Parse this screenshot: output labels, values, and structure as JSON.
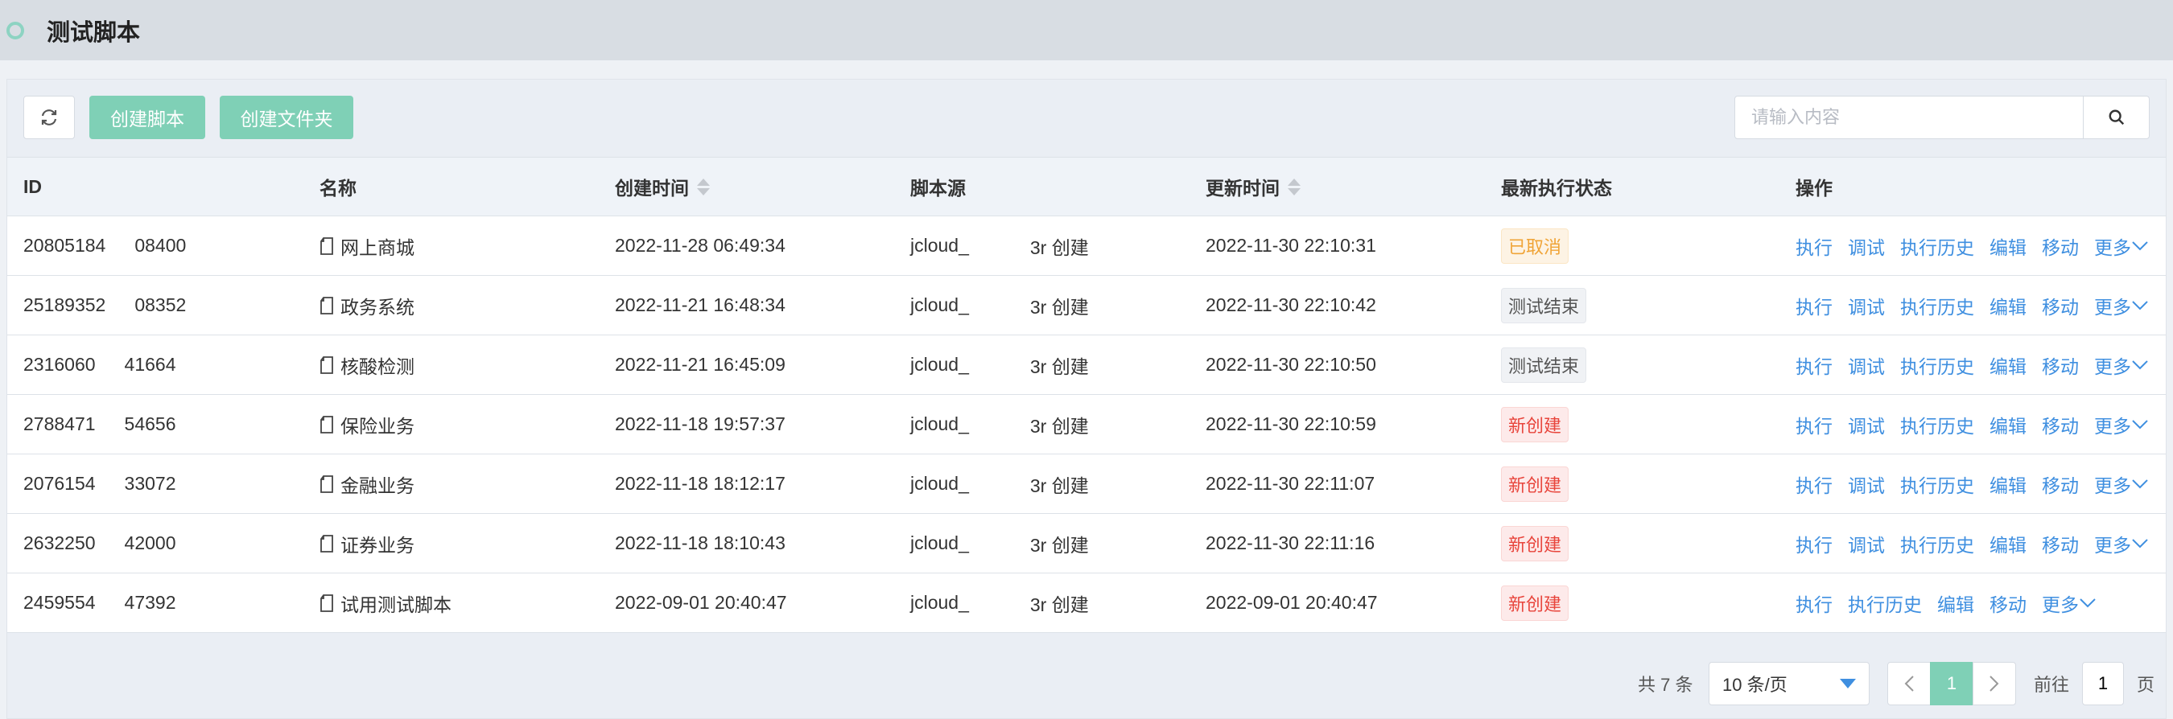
{
  "header": {
    "title": "测试脚本"
  },
  "toolbar": {
    "create_script_label": "创建脚本",
    "create_folder_label": "创建文件夹",
    "search_placeholder": "请输入内容"
  },
  "table": {
    "columns": [
      "ID",
      "名称",
      "创建时间",
      "脚本源",
      "更新时间",
      "最新执行状态",
      "操作"
    ],
    "rows": [
      {
        "id_prefix": "20805184",
        "id_suffix": "08400",
        "name": "网上商城",
        "created": "2022-11-28 06:49:34",
        "src_prefix": "jcloud_",
        "src_suffix": "3r 创建",
        "updated": "2022-11-30 22:10:31",
        "status": "已取消",
        "status_type": "cancel"
      },
      {
        "id_prefix": "25189352",
        "id_suffix": "08352",
        "name": "政务系统",
        "created": "2022-11-21 16:48:34",
        "src_prefix": "jcloud_",
        "src_suffix": "3r 创建",
        "updated": "2022-11-30 22:10:42",
        "status": "测试结束",
        "status_type": "done"
      },
      {
        "id_prefix": "2316060",
        "id_suffix": "41664",
        "name": "核酸检测",
        "created": "2022-11-21 16:45:09",
        "src_prefix": "jcloud_",
        "src_suffix": "3r 创建",
        "updated": "2022-11-30 22:10:50",
        "status": "测试结束",
        "status_type": "done"
      },
      {
        "id_prefix": "2788471",
        "id_suffix": "54656",
        "name": "保险业务",
        "created": "2022-11-18 19:57:37",
        "src_prefix": "jcloud_",
        "src_suffix": "3r 创建",
        "updated": "2022-11-30 22:10:59",
        "status": "新创建",
        "status_type": "new"
      },
      {
        "id_prefix": "2076154",
        "id_suffix": "33072",
        "name": "金融业务",
        "created": "2022-11-18 18:12:17",
        "src_prefix": "jcloud_",
        "src_suffix": "3r 创建",
        "updated": "2022-11-30 22:11:07",
        "status": "新创建",
        "status_type": "new"
      },
      {
        "id_prefix": "2632250",
        "id_suffix": "42000",
        "name": "证券业务",
        "created": "2022-11-18 18:10:43",
        "src_prefix": "jcloud_",
        "src_suffix": "3r 创建",
        "updated": "2022-11-30 22:11:16",
        "status": "新创建",
        "status_type": "new"
      },
      {
        "id_prefix": "2459554",
        "id_suffix": "47392",
        "name": "试用测试脚本",
        "created": "2022-09-01 20:40:47",
        "src_prefix": "jcloud_",
        "src_suffix": "3r 创建",
        "updated": "2022-09-01 20:40:47",
        "status": "新创建",
        "status_type": "new"
      }
    ],
    "ops_full": [
      "执行",
      "调试",
      "执行历史",
      "编辑",
      "移动"
    ],
    "ops_short": [
      "执行",
      "执行历史",
      "编辑",
      "移动"
    ],
    "more_label": "更多"
  },
  "pagination": {
    "total": "共 7 条",
    "page_size": "10 条/页",
    "current_page": "1",
    "goto_label": "前往",
    "goto_value": "1",
    "goto_suffix": "页"
  },
  "colors": {
    "accent": "#7fd0b6",
    "link": "#3f8fe0",
    "cancel": "#f0a437",
    "new": "#e8453c"
  }
}
